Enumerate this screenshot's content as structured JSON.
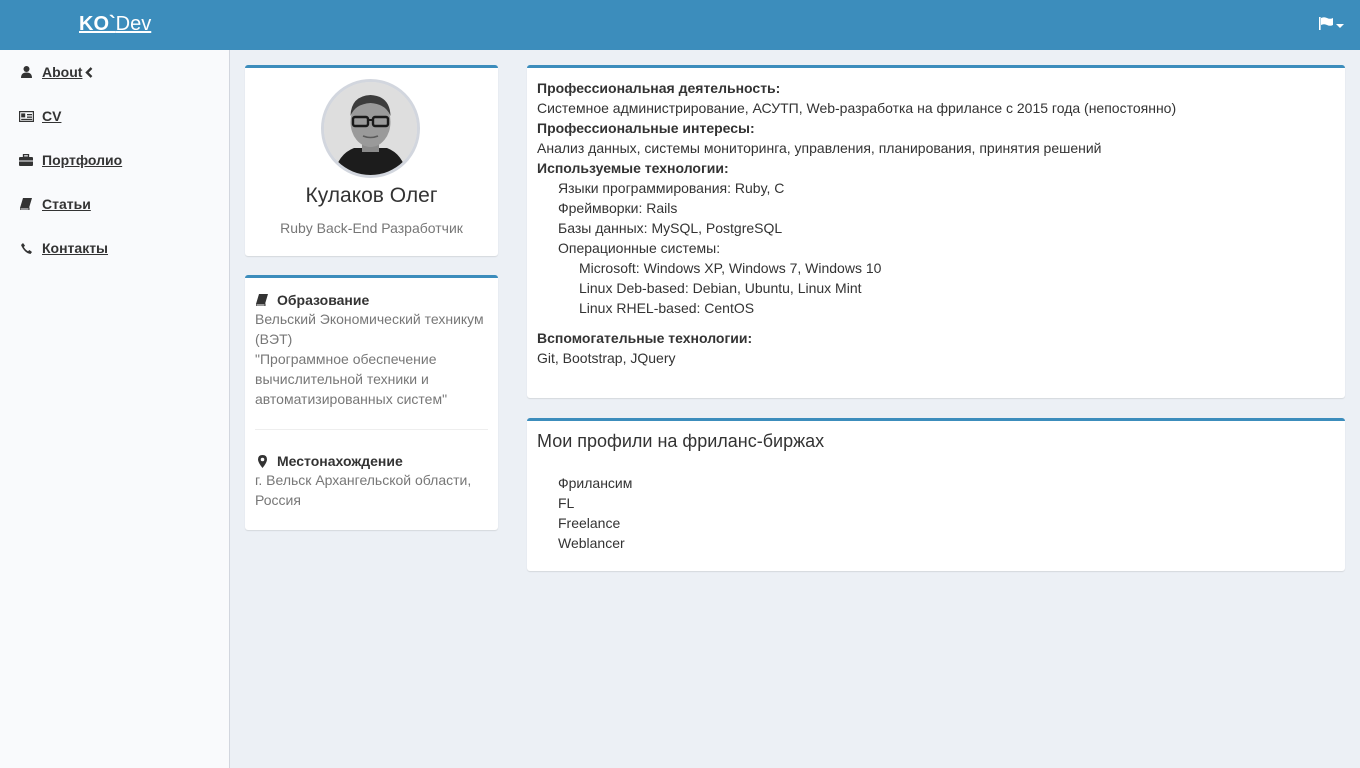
{
  "header": {
    "brand_bold": "KO`",
    "brand_rest": "Dev",
    "language_icon": "flag-icon"
  },
  "sidebar": {
    "items": [
      {
        "label": "About",
        "icon": "user-icon"
      },
      {
        "label": "CV",
        "icon": "id-card-icon"
      },
      {
        "label": "Портфолио",
        "icon": "briefcase-icon"
      },
      {
        "label": "Статьи",
        "icon": "book-icon"
      },
      {
        "label": "Контакты",
        "icon": "phone-icon"
      }
    ]
  },
  "profile": {
    "name": "Кулаков Олег",
    "role": "Ruby Back-End Разработчик"
  },
  "education": {
    "title": "Образование",
    "lines": [
      "Вельский Экономический техникум",
      "(ВЭТ)",
      "\"Программное обеспечение",
      "вычислительной техники и",
      "автоматизированных систем\""
    ]
  },
  "location": {
    "title": "Местонахождение",
    "lines": [
      "г. Вельск Архангельской области,",
      "Россия"
    ]
  },
  "about": {
    "activity_label": "Профессиональная деятельность:",
    "activity_text": "Системное администрирование, АСУТП, Web-разработка на фрилансе с 2015 года (непостоянно)",
    "interests_label": "Профессиональные интересы:",
    "interests_text": "Анализ данных, системы мониторинга, управления, планирования, принятия решений",
    "tech_label": "Используемые технологии:",
    "tech_items": [
      "Языки программирования: Ruby, C",
      "Фреймворки: Rails",
      "Базы данных: MySQL, PostgreSQL",
      "Операционные системы:"
    ],
    "os_items": [
      "Microsoft: Windows XP, Windows 7, Windows 10",
      "Linux Deb-based: Debian, Ubuntu, Linux Mint",
      "Linux RHEL-based: CentOS"
    ],
    "aux_label": "Вспомогательные технологии:",
    "aux_text": "Git, Bootstrap, JQuery"
  },
  "freelance": {
    "title": "Мои профили на фриланс-биржах",
    "items": [
      "Фрилансим",
      "FL",
      "Freelance",
      "Weblancer"
    ]
  },
  "colors": {
    "header": "#3c8dbc",
    "sidebar": "#f9fafc",
    "background": "#ecf0f5",
    "box_border": "#3c8dbc"
  }
}
